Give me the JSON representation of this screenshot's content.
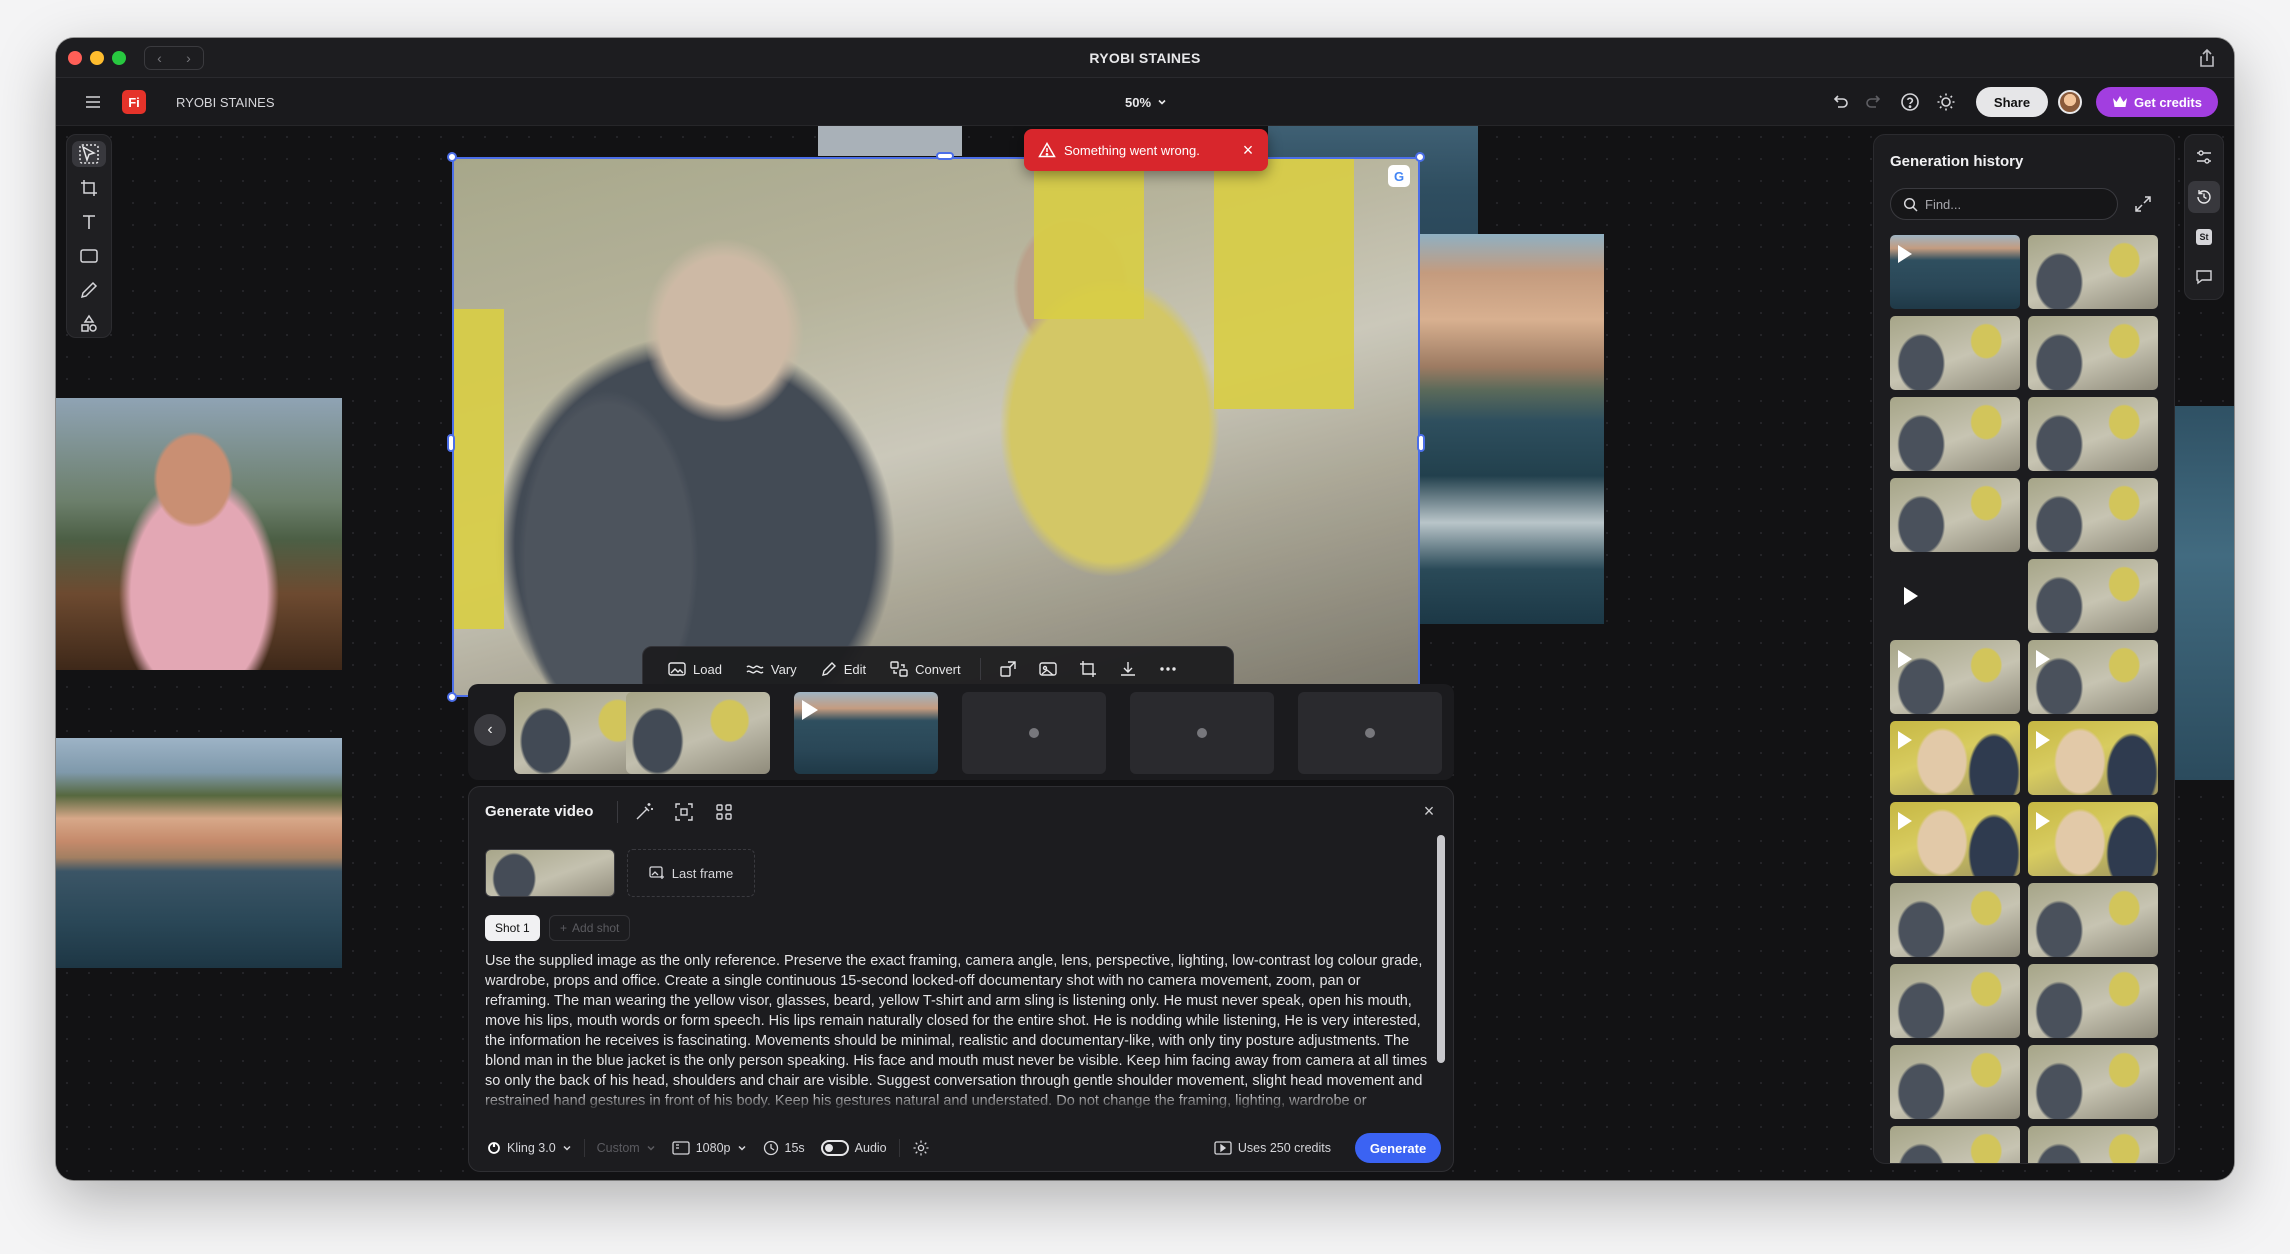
{
  "window": {
    "title": "RYOBI STAINES"
  },
  "app": {
    "logo_text": "Fi",
    "document_name": "RYOBI STAINES",
    "zoom_label": "50%",
    "share_label": "Share",
    "credits_label": "Get credits",
    "accent_color": "#a23ee0"
  },
  "toast": {
    "message": "Something went wrong.",
    "color": "#d8262c"
  },
  "image_toolbar": {
    "load": "Load",
    "vary": "Vary",
    "edit": "Edit",
    "convert": "Convert"
  },
  "generate": {
    "title": "Generate video",
    "last_frame_label": "Last frame",
    "shot_label": "Shot 1",
    "add_shot_label": "Add shot",
    "prompt": "Use the supplied image as the only reference. Preserve the exact framing, camera angle, lens, perspective, lighting, low-contrast log colour grade, wardrobe, props and office. Create a single continuous 15-second locked-off documentary shot with no camera movement, zoom, pan or reframing. The man wearing the yellow visor, glasses, beard, yellow T-shirt and arm sling is listening only. He must never speak, open his mouth, move his lips, mouth words or form speech. His lips remain naturally closed for the entire shot.  He is nodding while listening, He is very interested, the information he receives is fascinating. Movements should be minimal, realistic and documentary-like, with only tiny posture adjustments. The blond man in the blue jacket is the only person speaking. His face and mouth must never be visible. Keep him facing away from camera at all times so only the back of his head, shoulders and chair are visible. Suggest conversation through gentle shoulder movement, slight head movement and restrained hand gestures in front of his body. Keep his gestures natural and understated. Do not change the framing, lighting, wardrobe or background. The result should feel like a genuine observational documentary moment, quiet and real.",
    "model_label": "Kling 3.0",
    "custom_label": "Custom",
    "resolution_label": "1080p",
    "duration_label": "15s",
    "audio_label": "Audio",
    "credits_label": "Uses 250 credits",
    "generate_label": "Generate",
    "generate_color": "#3b63f3"
  },
  "history": {
    "title": "Generation history",
    "search_placeholder": "Find...",
    "thumbs": [
      {
        "kind": "boat",
        "video": true
      },
      {
        "kind": "office",
        "video": false
      },
      {
        "kind": "office",
        "video": false
      },
      {
        "kind": "office",
        "video": false
      },
      {
        "kind": "office",
        "video": false
      },
      {
        "kind": "office",
        "video": false
      },
      {
        "kind": "office",
        "video": false
      },
      {
        "kind": "office",
        "video": false
      },
      {
        "kind": "dark",
        "video": true
      },
      {
        "kind": "office",
        "video": false
      },
      {
        "kind": "office",
        "video": true
      },
      {
        "kind": "office",
        "video": true
      },
      {
        "kind": "yellow",
        "video": true
      },
      {
        "kind": "yellow",
        "video": true
      },
      {
        "kind": "yellow",
        "video": true
      },
      {
        "kind": "yellow",
        "video": true
      },
      {
        "kind": "office",
        "video": false
      },
      {
        "kind": "office",
        "video": false
      },
      {
        "kind": "office",
        "video": false
      },
      {
        "kind": "office",
        "video": false
      },
      {
        "kind": "office",
        "video": false
      },
      {
        "kind": "office",
        "video": false
      },
      {
        "kind": "office",
        "video": false
      },
      {
        "kind": "office",
        "video": false
      }
    ]
  },
  "icons": {
    "left_tools": [
      "select-icon",
      "frame-icon",
      "text-icon",
      "rectangle-icon",
      "pen-icon",
      "shapes-icon"
    ],
    "right_rail": [
      "adjust-icon",
      "history-icon",
      "stock-icon",
      "comment-icon"
    ]
  }
}
